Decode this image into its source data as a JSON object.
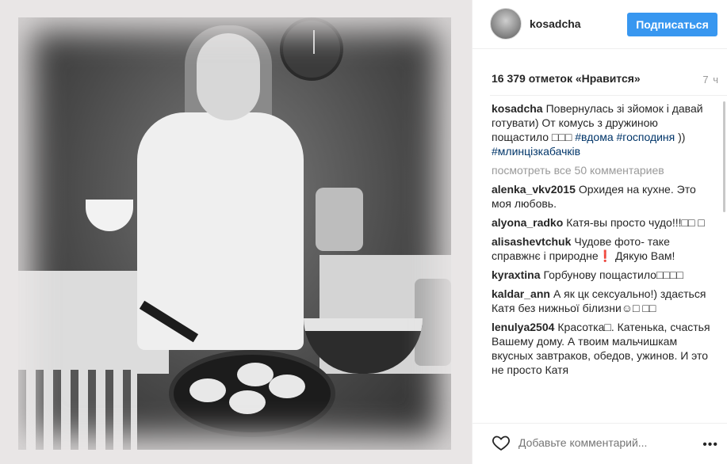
{
  "post": {
    "username": "kosadcha",
    "follow_label": "Подписаться",
    "likes": "16 379 отметок «Нравится»",
    "time_ago": "7 ч",
    "caption": {
      "author": "kosadcha",
      "text": "Повернулась зі зйомок і давай готувати) От комусь з дружиною пощастило",
      "hearts": "□□□",
      "tag1": "#вдома",
      "tag2": "#господиня",
      "after_tags": "))",
      "tag3": "#млинцізкабачків"
    },
    "view_all_comments": "посмотреть все 50 комментариев",
    "comments": [
      {
        "author": "alenka_vkv2015",
        "text": "Орхидея на кухне. Это моя любовь."
      },
      {
        "author": "alyona_radko",
        "text": "Катя-вы просто чудо!!!□□ □"
      },
      {
        "author": "alisashevtchuk",
        "text": "Чудове фото- таке справжнє і природне❗ Дякую Вам!"
      },
      {
        "author": "kyraxtina",
        "text": "Горбунову пощастило□□□□"
      },
      {
        "author": "kaldar_ann",
        "text": "А як цк сексуально!) здається Катя без нижньої білизни☺□ □□"
      },
      {
        "author": "lenulya2504",
        "text": "Красотка□. Катенька, счастья Вашему дому. А твоим мальчишкам вкусных завтраков, обедов, ужинов. И это не просто Катя"
      }
    ],
    "add_comment_placeholder": "Добавьте комментарий...",
    "more_icon": "•••"
  },
  "colors": {
    "follow_button": "#3897f0",
    "hashtag": "#003569",
    "muted": "#999999"
  },
  "icons": {
    "like": "heart-outline-icon",
    "options": "more-options-icon"
  }
}
